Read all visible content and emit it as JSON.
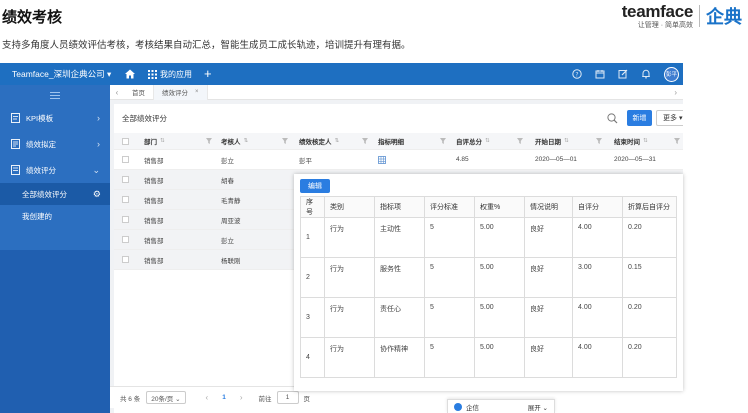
{
  "page": {
    "title": "绩效考核",
    "subtitle": "支持多角度人员绩效评估考核，考核结果自动汇总，智能生成员工成长轨迹，培训提升有理有据。"
  },
  "brand": {
    "wordmark": "teamface",
    "tagline": "让管理 · 简单高效",
    "cn_name": "企典"
  },
  "topbar": {
    "company": "Teamface_深圳企典公司 ▾",
    "apps_label": "我的应用",
    "plus": "+",
    "avatar": "彭平"
  },
  "sidebar": {
    "items": [
      {
        "label": "KPI模板",
        "chevron": "›"
      },
      {
        "label": "绩效拟定",
        "chevron": "›"
      },
      {
        "label": "绩效评分",
        "chevron": "⌄"
      }
    ],
    "subitems": [
      {
        "label": "全部绩效评分",
        "gear": "⚙"
      },
      {
        "label": "我创建的"
      }
    ]
  },
  "tabs": [
    {
      "label": "首页"
    },
    {
      "label": "绩效评分",
      "close": "×"
    }
  ],
  "panel": {
    "title": "全部绩效评分",
    "new_button": "新增",
    "more_button": "更多 ▾"
  },
  "grid": {
    "columns": [
      "部门",
      "考核人",
      "绩效核定人",
      "指标明细",
      "自评总分",
      "开始日期",
      "结束时间"
    ],
    "rows": [
      {
        "dept": "销售部",
        "person": "彭立",
        "approver": "彭平",
        "score": "4.85",
        "start": "2020—05—01",
        "end": "2020—05—31"
      },
      {
        "dept": "销售部",
        "person": "胡春"
      },
      {
        "dept": "销售部",
        "person": "毛青静"
      },
      {
        "dept": "销售部",
        "person": "周亚波"
      },
      {
        "dept": "销售部",
        "person": "彭立"
      },
      {
        "dept": "销售部",
        "person": "杨联刚"
      }
    ]
  },
  "detail": {
    "edit_button": "编辑",
    "columns": [
      "序号",
      "类别",
      "指标项",
      "评分标准",
      "权重%",
      "情况说明",
      "自评分",
      "折算后自评分"
    ],
    "rows": [
      {
        "seq": "1",
        "category": "行为",
        "item": "主动性",
        "standard": "5",
        "weight": "5.00",
        "note": "良好",
        "self": "4.00",
        "converted": "0.20"
      },
      {
        "seq": "2",
        "category": "行为",
        "item": "服务性",
        "standard": "5",
        "weight": "5.00",
        "note": "良好",
        "self": "3.00",
        "converted": "0.15"
      },
      {
        "seq": "3",
        "category": "行为",
        "item": "责任心",
        "standard": "5",
        "weight": "5.00",
        "note": "良好",
        "self": "4.00",
        "converted": "0.20"
      },
      {
        "seq": "4",
        "category": "行为",
        "item": "协作精神",
        "standard": "5",
        "weight": "5.00",
        "note": "良好",
        "self": "4.00",
        "converted": "0.20"
      }
    ]
  },
  "footer": {
    "total": "共 6 条",
    "page_size": "20条/页 ⌄",
    "prev": "‹",
    "page": "1",
    "next": "›",
    "goto_label": "前往",
    "goto_value": "1",
    "goto_unit": "页"
  },
  "chat": {
    "label": "企信",
    "expand": "展开 ⌄"
  },
  "colors": {
    "primary": "#1e6fc1",
    "sidebar": "#2c6fc0",
    "accent": "#2a7de1"
  }
}
